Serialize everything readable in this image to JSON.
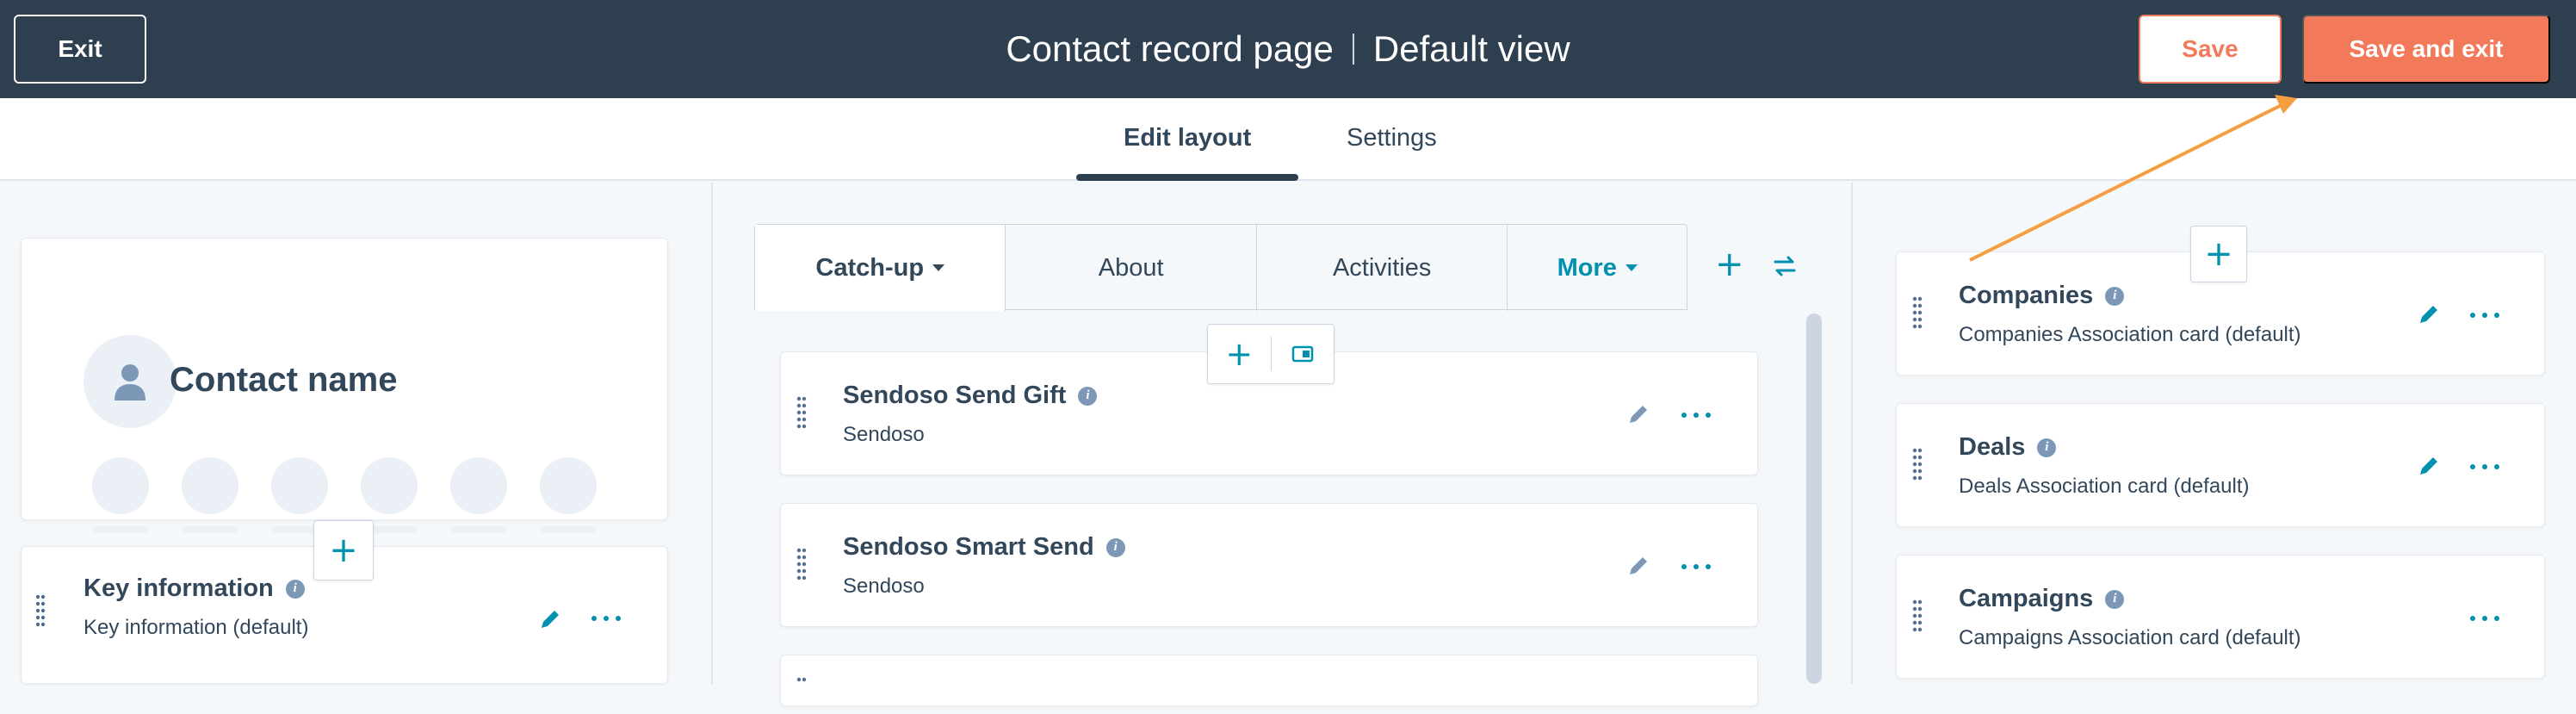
{
  "header": {
    "exit_label": "Exit",
    "title_main": "Contact record page",
    "title_view": "Default view",
    "save_label": "Save",
    "save_exit_label": "Save and exit"
  },
  "tabs": [
    {
      "label": "Edit layout",
      "active": true
    },
    {
      "label": "Settings",
      "active": false
    }
  ],
  "left": {
    "contact_name": "Contact name",
    "key_info": {
      "title": "Key information",
      "subtitle": "Key information (default)"
    }
  },
  "middle": {
    "tabs": [
      "Catch-up",
      "About",
      "Activities",
      "More"
    ],
    "cards": [
      {
        "title": "Sendoso Send Gift",
        "subtitle": "Sendoso"
      },
      {
        "title": "Sendoso Smart Send",
        "subtitle": "Sendoso"
      }
    ]
  },
  "right": {
    "cards": [
      {
        "title": "Companies",
        "subtitle": "Companies Association card (default)"
      },
      {
        "title": "Deals",
        "subtitle": "Deals Association card (default)"
      },
      {
        "title": "Campaigns",
        "subtitle": "Campaigns Association card (default)"
      }
    ]
  },
  "colors": {
    "header_bg": "#2e3f50",
    "accent": "#f2795a",
    "link": "#0091ae",
    "annotation_arrow": "#f59e3f"
  },
  "icons": [
    "person-icon",
    "info-icon",
    "drag-handle-icon",
    "pencil-icon",
    "more-dots-icon",
    "plus-icon",
    "layout-icon",
    "swap-icon"
  ]
}
